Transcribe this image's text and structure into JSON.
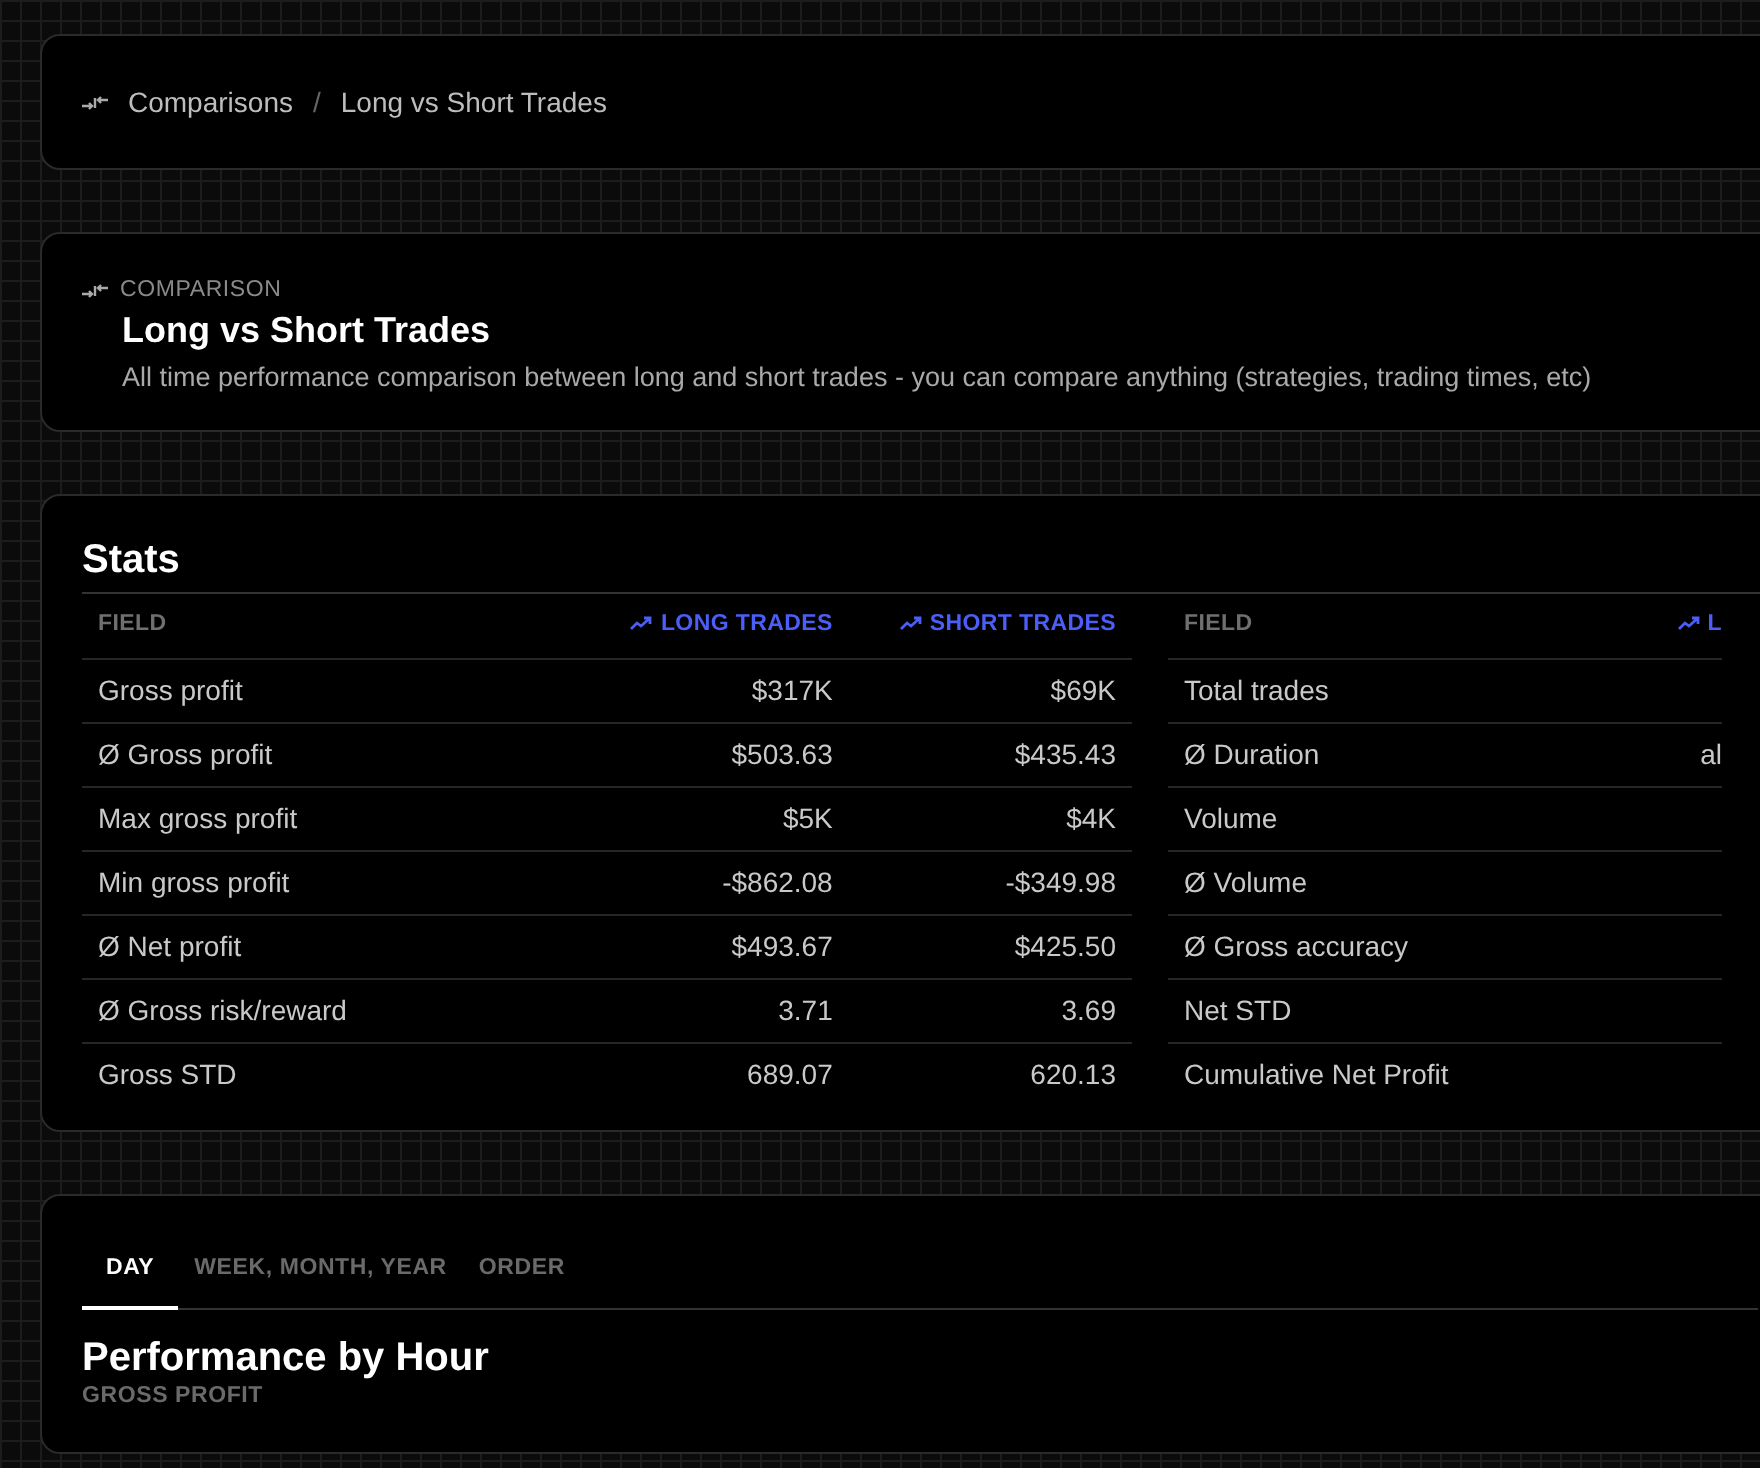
{
  "breadcrumb": {
    "items": [
      "Comparisons",
      "Long vs Short Trades"
    ],
    "separator": "/"
  },
  "header": {
    "eyebrow": "COMPARISON",
    "title": "Long vs Short Trades",
    "description": "All time performance comparison between long and short trades - you can compare anything (strategies, trading times, etc)"
  },
  "stats": {
    "title": "Stats",
    "tables": [
      {
        "columns": [
          {
            "label": "FIELD",
            "kind": "field"
          },
          {
            "label": "LONG TRADES",
            "kind": "series"
          },
          {
            "label": "SHORT TRADES",
            "kind": "series"
          }
        ],
        "rows": [
          [
            "Gross profit",
            "$317K",
            "$69K"
          ],
          [
            "Ø Gross profit",
            "$503.63",
            "$435.43"
          ],
          [
            "Max gross profit",
            "$5K",
            "$4K"
          ],
          [
            "Min gross profit",
            "-$862.08",
            "-$349.98"
          ],
          [
            "Ø Net profit",
            "$493.67",
            "$425.50"
          ],
          [
            "Ø Gross risk/reward",
            "3.71",
            "3.69"
          ],
          [
            "Gross STD",
            "689.07",
            "620.13"
          ]
        ]
      },
      {
        "columns": [
          {
            "label": "FIELD",
            "kind": "field"
          },
          {
            "label": "L",
            "kind": "series"
          }
        ],
        "rows": [
          [
            "Total trades"
          ],
          [
            "Ø Duration",
            "al"
          ],
          [
            "Volume"
          ],
          [
            "Ø Volume"
          ],
          [
            "Ø Gross accuracy"
          ],
          [
            "Net STD"
          ],
          [
            "Cumulative Net Profit"
          ]
        ]
      }
    ]
  },
  "performance": {
    "tabs": [
      {
        "label": "DAY",
        "selected": true
      },
      {
        "label": "WEEK, MONTH, YEAR",
        "selected": false
      },
      {
        "label": "ORDER",
        "selected": false
      }
    ],
    "title": "Performance by Hour",
    "subtitle": "GROSS PROFIT"
  }
}
